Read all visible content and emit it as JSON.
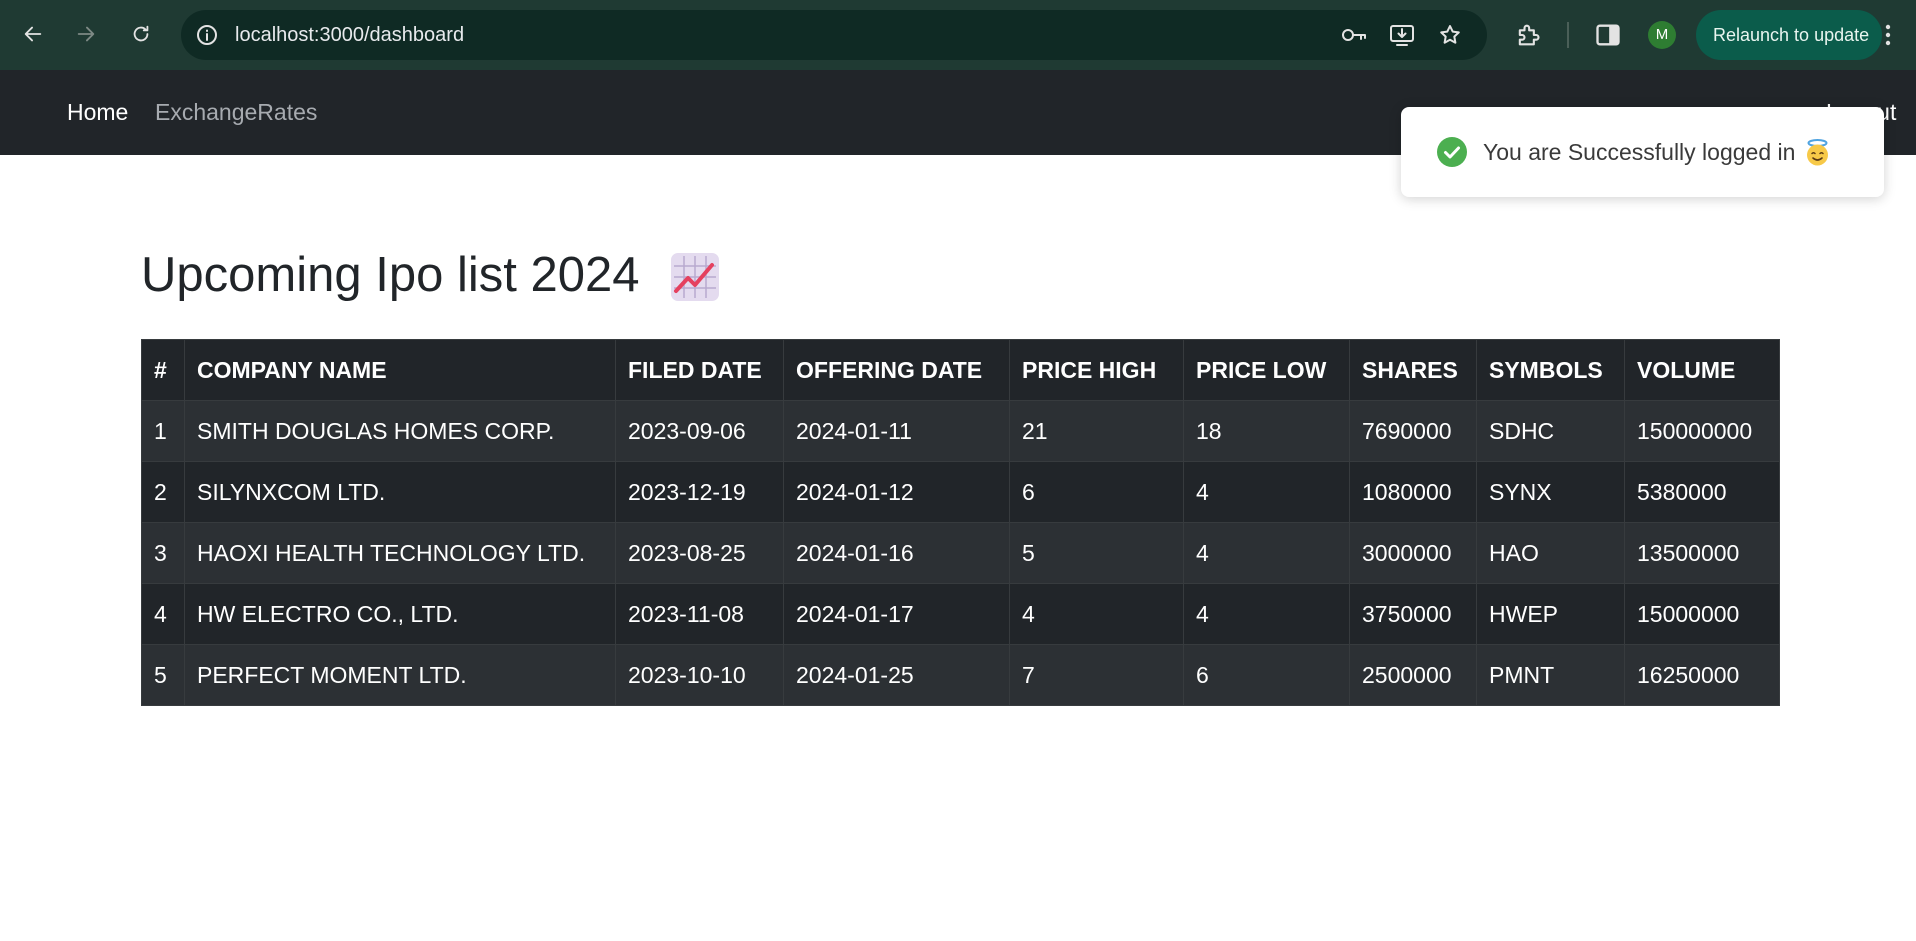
{
  "browser": {
    "url": "localhost:3000/dashboard",
    "relaunch_label": "Relaunch to update",
    "profile_initial": "M"
  },
  "navbar": {
    "home_label": "Home",
    "exchange_label": "ExchangeRates",
    "logout_label": "Logout"
  },
  "toast": {
    "message": "You are Successfully logged in",
    "status_color": "#4caf50",
    "icon": "check-circle-icon"
  },
  "page": {
    "title": "Upcoming Ipo list 2024"
  },
  "table": {
    "headers": [
      "#",
      "COMPANY NAME",
      "FILED DATE",
      "OFFERING DATE",
      "PRICE HIGH",
      "PRICE LOW",
      "SHARES",
      "SYMBOLS",
      "VOLUME"
    ],
    "rows": [
      [
        "1",
        "SMITH DOUGLAS HOMES CORP.",
        "2023-09-06",
        "2024-01-11",
        "21",
        "18",
        "7690000",
        "SDHC",
        "150000000"
      ],
      [
        "2",
        "SILYNXCOM LTD.",
        "2023-12-19",
        "2024-01-12",
        "6",
        "4",
        "1080000",
        "SYNX",
        "5380000"
      ],
      [
        "3",
        "HAOXI HEALTH TECHNOLOGY LTD.",
        "2023-08-25",
        "2024-01-16",
        "5",
        "4",
        "3000000",
        "HAO",
        "13500000"
      ],
      [
        "4",
        "HW ELECTRO CO., LTD.",
        "2023-11-08",
        "2024-01-17",
        "4",
        "4",
        "3750000",
        "HWEP",
        "15000000"
      ],
      [
        "5",
        "PERFECT MOMENT LTD.",
        "2023-10-10",
        "2024-01-25",
        "7",
        "6",
        "2500000",
        "PMNT",
        "16250000"
      ]
    ]
  },
  "colors": {
    "chrome_bg": "#1f3a33",
    "navbar_bg": "#212529",
    "table_dark": "#212529",
    "table_stripe": "#2c3034"
  }
}
